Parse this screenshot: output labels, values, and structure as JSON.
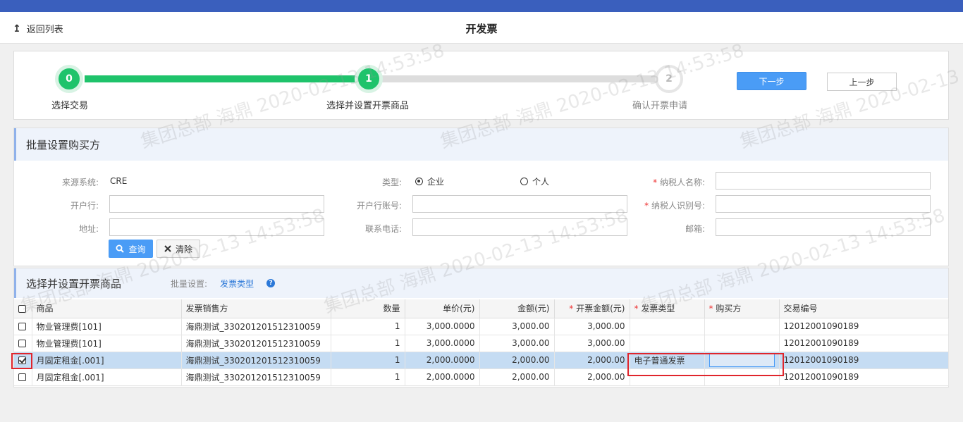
{
  "header": {
    "back_label": "返回列表",
    "back_icon": "↥",
    "title": "开发票"
  },
  "steps": {
    "items": [
      {
        "number": "0",
        "label": "选择交易",
        "state": "done"
      },
      {
        "number": "1",
        "label": "选择并设置开票商品",
        "state": "current"
      },
      {
        "number": "2",
        "label": "确认开票申请",
        "state": "todo"
      }
    ],
    "next_label": "下一步",
    "prev_label": "上一步"
  },
  "buyer": {
    "heading": "批量设置购买方",
    "source_label": "来源系统:",
    "source_value": "CRE",
    "type_label": "类型:",
    "type_options": [
      "企业",
      "个人"
    ],
    "type_selected": "企业",
    "taxpayer_name_label": "纳税人名称:",
    "bank_label": "开户行:",
    "bank_account_label": "开户行账号:",
    "taxpayer_id_label": "纳税人识别号:",
    "address_label": "地址:",
    "phone_label": "联系电话:",
    "email_label": "邮箱:",
    "required_mark": "*",
    "query_label": "查询",
    "clear_label": "清除"
  },
  "goods": {
    "heading": "选择并设置开票商品",
    "batch_label": "批量设置:",
    "batch_link": "发票类型",
    "help_icon": "?",
    "columns": [
      "商品",
      "发票销售方",
      "数量",
      "单价(元)",
      "金额(元)",
      "开票金额(元)",
      "发票类型",
      "购买方",
      "交易编号"
    ],
    "rows": [
      {
        "checked": false,
        "product": "物业管理费[101]",
        "seller": "海鼎测试_330201201512310059",
        "qty": "1",
        "price": "3,000.0000",
        "amount": "3,000.00",
        "invoice_amount": "3,000.00",
        "invoice_type": "",
        "buyer": "",
        "trade_no": "12012001090189"
      },
      {
        "checked": false,
        "product": "物业管理费[101]",
        "seller": "海鼎测试_330201201512310059",
        "qty": "1",
        "price": "3,000.0000",
        "amount": "3,000.00",
        "invoice_amount": "3,000.00",
        "invoice_type": "",
        "buyer": "",
        "trade_no": "12012001090189"
      },
      {
        "checked": true,
        "product": "月固定租金[.001]",
        "seller": "海鼎测试_330201201512310059",
        "qty": "1",
        "price": "2,000.0000",
        "amount": "2,000.00",
        "invoice_amount": "2,000.00",
        "invoice_type": "电子普通发票",
        "buyer": "",
        "trade_no": "12012001090189"
      },
      {
        "checked": false,
        "product": "月固定租金[.001]",
        "seller": "海鼎测试_330201201512310059",
        "qty": "1",
        "price": "2,000.0000",
        "amount": "2,000.00",
        "invoice_amount": "2,000.00",
        "invoice_type": "",
        "buyer": "",
        "trade_no": "12012001090189"
      }
    ]
  },
  "watermark": "集团总部 海鼎 2020-02-13 14:53:58",
  "colors": {
    "accent": "#4a9cf6",
    "progress": "#1fc36b",
    "topbar": "#3a5fbd",
    "highlight_box": "#e0252c"
  }
}
